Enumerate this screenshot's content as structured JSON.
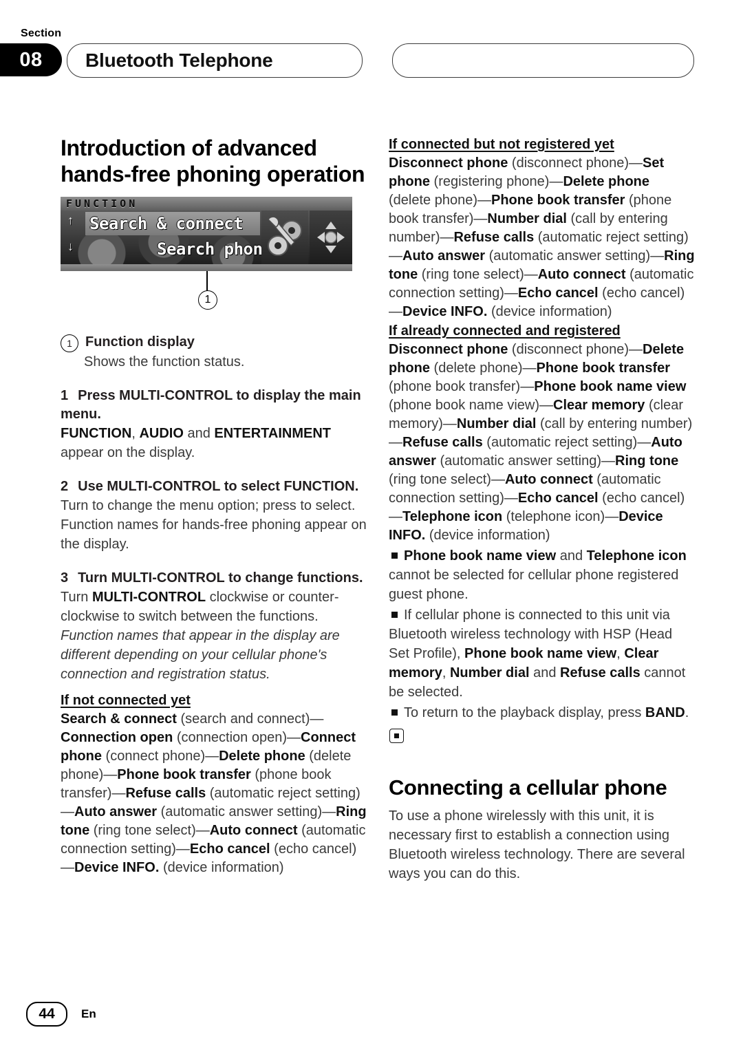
{
  "header": {
    "section_word": "Section",
    "section_number": "08",
    "title": "Bluetooth Telephone"
  },
  "left_column": {
    "heading": "Introduction of advanced hands-free phoning operation",
    "lcd": {
      "function_label": "FUNCTION",
      "line1": "Search & connect",
      "line2": "Search phone",
      "arrow_up": "↑",
      "arrow_down": "↓",
      "callout_number": "1",
      "tool_icon": "wrench-and-gears-icon",
      "pad_icon": "joystick-dpad-icon"
    },
    "legend": {
      "number": "1",
      "label": "Function display",
      "description": "Shows the function status."
    },
    "steps": [
      {
        "number": "1",
        "title": "Press MULTI-CONTROL to display the main menu.",
        "body_html": "<b>FUNCTION</b>, <b>AUDIO</b> and <b>ENTERTAINMENT</b> appear on the display."
      },
      {
        "number": "2",
        "title": "Use MULTI-CONTROL to select FUNCTION.",
        "body_html": "Turn to change the menu option; press to select.<br>Function names for hands-free phoning appear on the display."
      },
      {
        "number": "3",
        "title": "Turn MULTI-CONTROL to change functions.",
        "body_html": "Turn <b>MULTI-CONTROL</b> clockwise or counter-clockwise to switch between the functions.",
        "italic_note": "Function names that appear in the display are different depending on your cellular phone's connection and registration status."
      }
    ],
    "state_not_connected": {
      "heading": "If not connected yet",
      "items_html": "<b>Search &amp; connect</b> (search and connect)—<b>Connection open</b> (connection open)—<b>Connect phone</b> (connect phone)—<b>Delete phone</b> (delete phone)—<b>Phone book transfer</b> (phone book transfer)—<b>Refuse calls</b> (automatic reject setting)—<b>Auto answer</b> (automatic answer setting)—<b>Ring tone</b> (ring tone select)—<b>Auto connect</b> (automatic connection setting)—<b>Echo cancel</b> (echo cancel)—<b>Device INFO.</b> (device information)"
    }
  },
  "right_column": {
    "state_connected_not_registered": {
      "heading": "If connected but not registered yet",
      "items_html": "<b>Disconnect phone</b> (disconnect phone)—<b>Set phone</b> (registering phone)—<b>Delete phone</b> (delete phone)—<b>Phone book transfer</b> (phone book transfer)—<b>Number dial</b> (call by entering number)—<b>Refuse calls</b> (automatic reject setting)—<b>Auto answer</b> (automatic answer setting)—<b>Ring tone</b> (ring tone select)—<b>Auto connect</b> (automatic connection setting)—<b>Echo cancel</b> (echo cancel)—<b>Device INFO.</b> (device information)"
    },
    "state_connected_and_registered": {
      "heading": "If already connected and registered",
      "items_html": "<b>Disconnect phone</b> (disconnect phone)—<b>Delete phone</b> (delete phone)—<b>Phone book transfer</b> (phone book transfer)—<b>Phone book name view</b> (phone book name view)—<b>Clear memory</b> (clear memory)—<b>Number dial</b> (call by entering number)—<b>Refuse calls</b> (automatic reject setting)—<b>Auto answer</b> (automatic answer setting)—<b>Ring tone</b> (ring tone select)—<b>Auto connect</b> (automatic connection setting)—<b>Echo cancel</b> (echo cancel)—<b>Telephone icon</b> (telephone icon)—<b>Device INFO.</b> (device information)"
    },
    "notes": [
      "<b>Phone book name view</b> and <b>Telephone icon</b> cannot be selected for cellular phone registered guest phone.",
      "If cellular phone is connected to this unit via Bluetooth wireless technology with HSP (Head Set Profile), <b>Phone book name view</b>, <b>Clear memory</b>, <b>Number dial</b> and <b>Refuse calls</b> cannot be selected.",
      "To return to the playback display, press <b>BAND</b>."
    ],
    "connecting_section": {
      "heading": "Connecting a cellular phone",
      "body": "To use a phone wirelessly with this unit, it is necessary first to establish a connection using Bluetooth wireless technology. There are several ways you can do this."
    }
  },
  "footer": {
    "page_number": "44",
    "language": "En"
  }
}
